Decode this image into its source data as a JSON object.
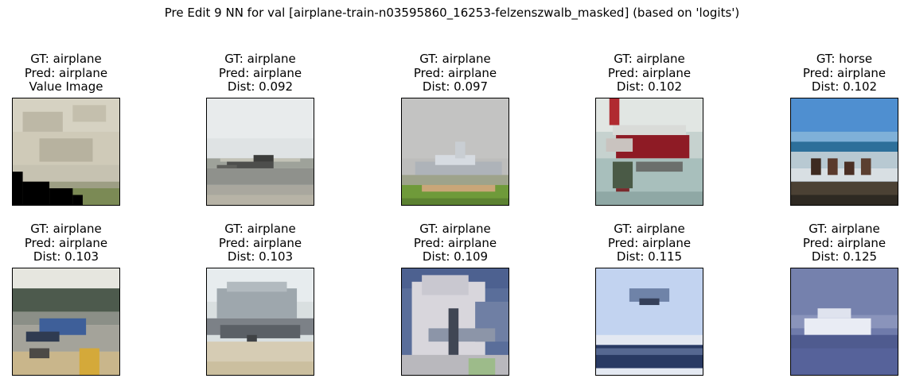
{
  "title": "Pre Edit 9 NN for val [airplane-train-n03595860_16253-felzenszwalb_masked] (based on 'logits')",
  "panels": [
    {
      "gt": "GT: airplane",
      "pred": "Pred: airplane",
      "extra": "Value Image"
    },
    {
      "gt": "GT: airplane",
      "pred": "Pred: airplane",
      "extra": "Dist: 0.092"
    },
    {
      "gt": "GT: airplane",
      "pred": "Pred: airplane",
      "extra": "Dist: 0.097"
    },
    {
      "gt": "GT: airplane",
      "pred": "Pred: airplane",
      "extra": "Dist: 0.102"
    },
    {
      "gt": "GT: horse",
      "pred": "Pred: airplane",
      "extra": "Dist: 0.102"
    },
    {
      "gt": "GT: airplane",
      "pred": "Pred: airplane",
      "extra": "Dist: 0.103"
    },
    {
      "gt": "GT: airplane",
      "pred": "Pred: airplane",
      "extra": "Dist: 0.103"
    },
    {
      "gt": "GT: airplane",
      "pred": "Pred: airplane",
      "extra": "Dist: 0.109"
    },
    {
      "gt": "GT: airplane",
      "pred": "Pred: airplane",
      "extra": "Dist: 0.115"
    },
    {
      "gt": "GT: airplane",
      "pred": "Pred: airplane",
      "extra": "Dist: 0.125"
    }
  ]
}
